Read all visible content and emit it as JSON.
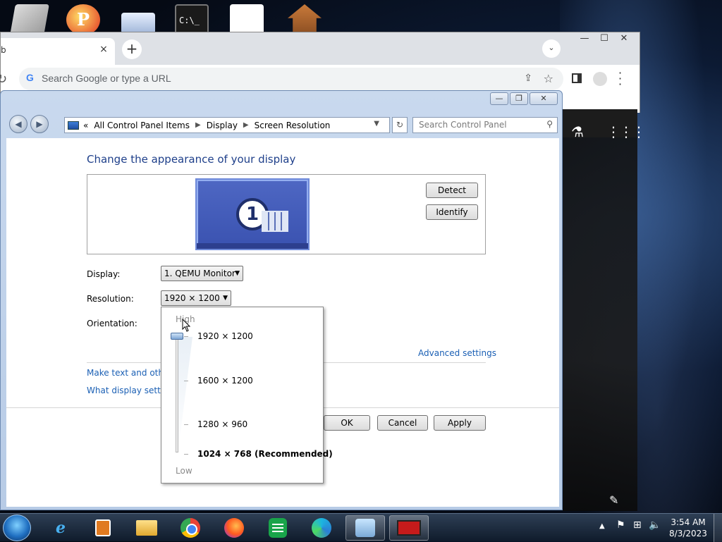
{
  "chrome": {
    "tab_title": "b",
    "tab_close": "×",
    "new_tab": "+",
    "tab_search": "⌄",
    "win_min": "—",
    "win_max": "☐",
    "win_close": "✕",
    "omnibox_placeholder": "Search Google or type a URL",
    "google_icon": "G"
  },
  "control_panel": {
    "breadcrumb": {
      "prefix": "«",
      "items": [
        "All Control Panel Items",
        "Display",
        "Screen Resolution"
      ]
    },
    "search_placeholder": "Search Control Panel",
    "heading": "Change the appearance of your display",
    "monitor_number": "1",
    "detect_label": "Detect",
    "identify_label": "Identify",
    "display_label": "Display:",
    "display_value": "1. QEMU Monitor",
    "resolution_label": "Resolution:",
    "resolution_value": "1920 × 1200",
    "orientation_label": "Orientation:",
    "advanced_link": "Advanced settings",
    "link_make_text": "Make text and other",
    "link_what_settings": "What display setting",
    "ok_label": "OK",
    "cancel_label": "Cancel",
    "apply_label": "Apply"
  },
  "resolution_dropdown": {
    "high_label": "High",
    "low_label": "Low",
    "options": [
      "1920 × 1200",
      "1600 × 1200",
      "1280 × 960",
      "1024 × 768 (Recommended)"
    ],
    "slider_level": 1.0
  },
  "taskbar": {
    "clock_time": "3:54 AM",
    "clock_date": "8/3/2023"
  },
  "colors": {
    "link_blue": "#1a5fb4",
    "heading_blue": "#1e3f8a",
    "monitor_blue": "#4e67c3"
  }
}
